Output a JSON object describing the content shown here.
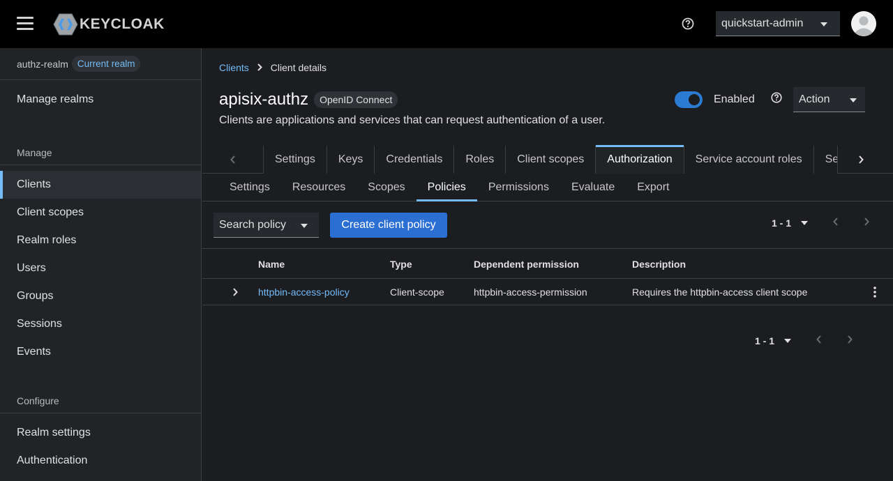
{
  "masthead": {
    "logo_text": "KEYCLOAK",
    "user_menu_label": "quickstart-admin"
  },
  "sidebar": {
    "realm_name": "authz-realm",
    "realm_badge": "Current realm",
    "manage_realms": "Manage realms",
    "section_manage": "Manage",
    "manage_items": [
      "Clients",
      "Client scopes",
      "Realm roles",
      "Users",
      "Groups",
      "Sessions",
      "Events"
    ],
    "section_configure": "Configure",
    "configure_items": [
      "Realm settings",
      "Authentication"
    ]
  },
  "breadcrumb": {
    "parent": "Clients",
    "current": "Client details"
  },
  "client": {
    "name": "apisix-authz",
    "protocol_badge": "OpenID Connect",
    "description": "Clients are applications and services that can request authentication of a user.",
    "enabled_label": "Enabled",
    "enabled": true,
    "action_label": "Action"
  },
  "tabs": [
    "Settings",
    "Keys",
    "Credentials",
    "Roles",
    "Client scopes",
    "Authorization",
    "Service account roles",
    "Se"
  ],
  "active_tab": "Authorization",
  "subtabs": [
    "Settings",
    "Resources",
    "Scopes",
    "Policies",
    "Permissions",
    "Evaluate",
    "Export"
  ],
  "active_subtab": "Policies",
  "toolbar": {
    "search_label": "Search policy",
    "create_label": "Create client policy",
    "pagination_top": "1 - 1",
    "pagination_bottom": "1 - 1"
  },
  "table": {
    "headers": [
      "Name",
      "Type",
      "Dependent permission",
      "Description"
    ],
    "rows": [
      {
        "name": "httpbin-access-policy",
        "type": "Client-scope",
        "dependent_permission": "httpbin-access-permission",
        "description": "Requires the httpbin-access client scope"
      }
    ]
  },
  "colors": {
    "accent": "#73bcf7",
    "primary_button": "#2b6fd3",
    "toggle_on": "#2b7bd3",
    "masthead_bg": "#000000",
    "page_bg": "#1b1d21"
  }
}
